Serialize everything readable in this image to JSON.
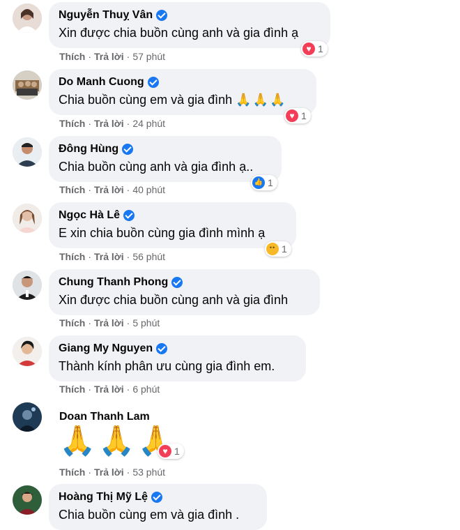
{
  "actions": {
    "like": "Thích",
    "reply": "Trả lời"
  },
  "comments": [
    {
      "name": "Nguyễn Thuỵ Vân",
      "verified": true,
      "text": "Xin được chia buồn cùng anh và gia đình ạ",
      "time": "57 phút",
      "reaction": {
        "type": "love",
        "count": "1"
      }
    },
    {
      "name": "Do Manh Cuong",
      "verified": true,
      "text": "Chia buồn cùng em và gia đình",
      "emoji": "🙏🙏🙏",
      "time": "24 phút",
      "reaction": {
        "type": "love",
        "count": "1"
      }
    },
    {
      "name": "Đông Hùng",
      "verified": true,
      "text": "Chia buồn cùng anh và gia đình ạ..",
      "time": "40 phút",
      "reaction": {
        "type": "like",
        "count": "1"
      }
    },
    {
      "name": "Ngọc Hà Lê",
      "verified": true,
      "text": "E xin chia buồn cùng gia đình mình ạ",
      "time": "56 phút",
      "reaction": {
        "type": "care",
        "count": "1"
      }
    },
    {
      "name": "Chung Thanh Phong",
      "verified": true,
      "text": "Xin được chia buồn cùng anh và gia đình",
      "time": "5 phút"
    },
    {
      "name": "Giang My Nguyen",
      "verified": true,
      "text": "Thành kính phân ưu cùng gia đình em.",
      "time": "6 phút"
    },
    {
      "name": "Doan Thanh Lam",
      "verified": false,
      "emoji": "🙏🙏🙏",
      "time": "53 phút",
      "reaction": {
        "type": "love",
        "count": "1"
      }
    },
    {
      "name": "Hoàng Thị Mỹ Lệ",
      "verified": true,
      "text": "Chia buồn cùng em và gia đình ."
    }
  ]
}
